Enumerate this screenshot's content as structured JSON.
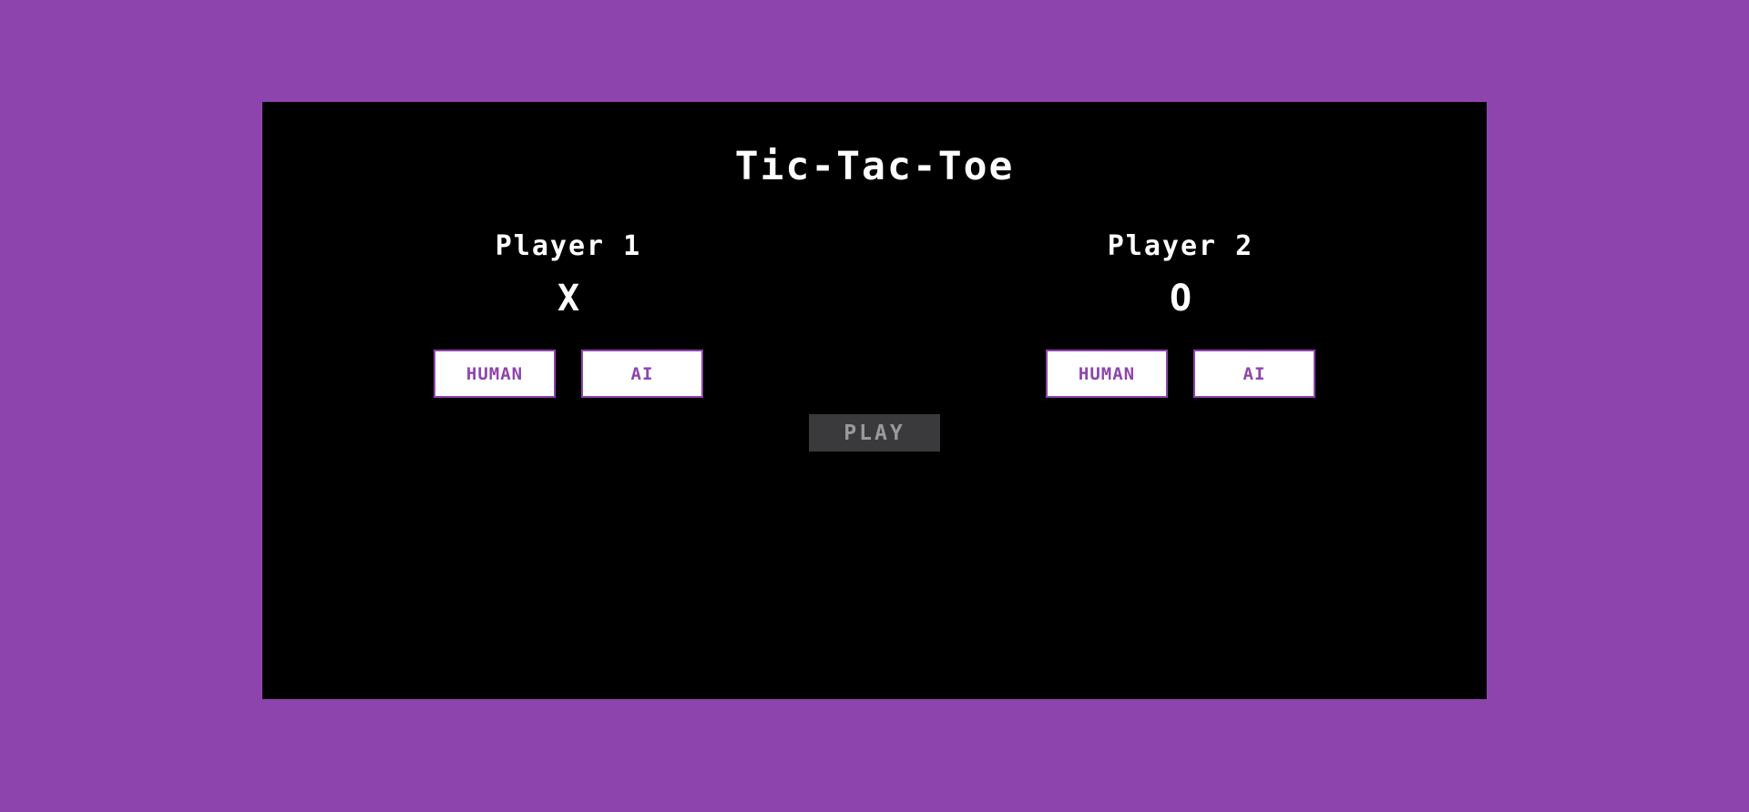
{
  "game": {
    "title": "Tic-Tac-Toe"
  },
  "players": [
    {
      "name": "Player 1",
      "symbol": "X",
      "options": [
        "HUMAN",
        "AI"
      ]
    },
    {
      "name": "Player 2",
      "symbol": "O",
      "options": [
        "HUMAN",
        "AI"
      ]
    }
  ],
  "controls": {
    "play_label": "PLAY"
  },
  "colors": {
    "background": "#8e44ad",
    "board": "#000000",
    "text": "#ffffff",
    "button_text": "#8e44ad",
    "play_button": "#3a3a3c",
    "play_text": "#9a9a9a"
  }
}
